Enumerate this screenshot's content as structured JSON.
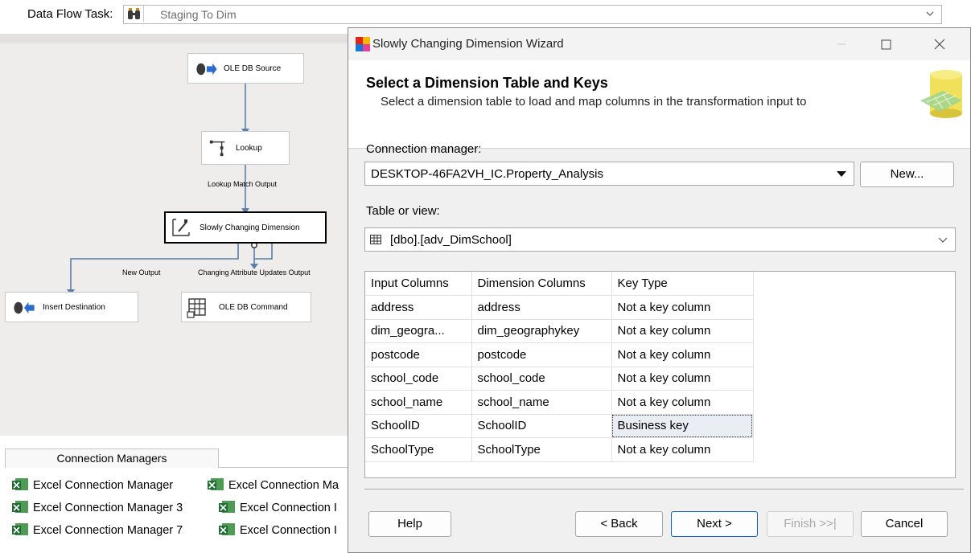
{
  "taskbar": {
    "label": "Data Flow Task:",
    "selected_task": "Staging To Dim"
  },
  "canvas": {
    "nodes": {
      "ole_db_source": "OLE DB Source",
      "lookup": "Lookup",
      "scd": "Slowly Changing Dimension",
      "insert_destination": "Insert Destination",
      "ole_db_command": "OLE DB Command"
    },
    "flows": {
      "lookup_match_output": "Lookup Match Output",
      "new_output": "New Output",
      "changing_attribute_updates_output": "Changing Attribute Updates Output"
    }
  },
  "connection_managers": {
    "tab_label": "Connection Managers",
    "items": [
      "Excel Connection Manager",
      "Excel Connection Ma",
      "Excel Connection Manager 3",
      "Excel Connection I",
      "Excel Connection Manager 7",
      "Excel Connection I"
    ]
  },
  "wizard": {
    "title": "Slowly Changing Dimension Wizard",
    "heading": "Select a Dimension Table and Keys",
    "subheading": "Select a dimension table to load and map columns in the transformation input to",
    "connection_label": "Connection manager:",
    "connection_value": "DESKTOP-46FA2VH_IC.Property_Analysis",
    "new_button": "New...",
    "table_label": "Table or view:",
    "table_value": "[dbo].[adv_DimSchool]",
    "grid": {
      "headers": [
        "Input Columns",
        "Dimension Columns",
        "Key Type"
      ],
      "rows": [
        [
          "address",
          "address",
          "Not a key column"
        ],
        [
          "dim_geogra...",
          "dim_geographykey",
          "Not a key column"
        ],
        [
          "postcode",
          "postcode",
          "Not a key column"
        ],
        [
          "school_code",
          "school_code",
          "Not a key column"
        ],
        [
          "school_name",
          "school_name",
          "Not a key column"
        ],
        [
          "SchoolID",
          "SchoolID",
          "Business key"
        ],
        [
          "SchoolType",
          "SchoolType",
          "Not a key column"
        ]
      ]
    },
    "buttons": {
      "help": "Help",
      "back": "< Back",
      "next": "Next >",
      "finish": "Finish >>|",
      "cancel": "Cancel"
    }
  },
  "colors": {
    "canvas_bg": "#eeedec",
    "wizard_bg": "#f0f0f0",
    "primary_border": "#0a64c8",
    "selected_cell": "#e9eef4"
  }
}
